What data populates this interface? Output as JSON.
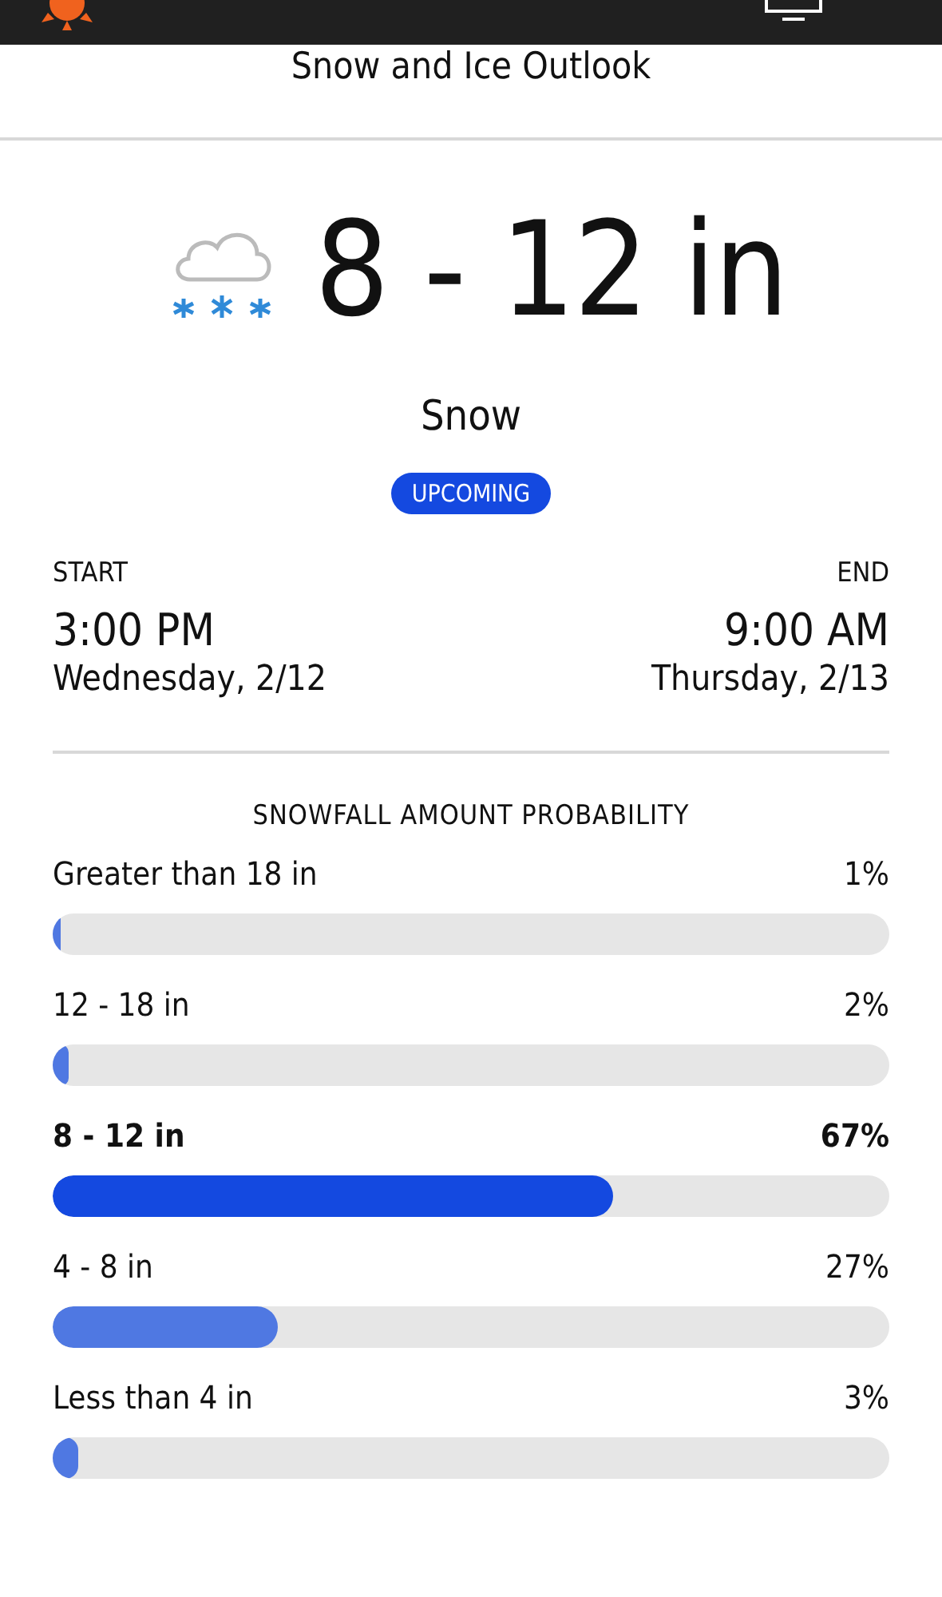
{
  "header": {
    "title": "Snow and Ice Outlook"
  },
  "forecast": {
    "amount": "8 - 12 in",
    "condition": "Snow",
    "badge": "UPCOMING"
  },
  "start": {
    "label": "START",
    "time": "3:00 PM",
    "date": "Wednesday, 2/12"
  },
  "end": {
    "label": "END",
    "time": "9:00 AM",
    "date": "Thursday, 2/13"
  },
  "probability": {
    "title": "SNOWFALL AMOUNT PROBABILITY",
    "rows": [
      {
        "label": "Greater than 18 in",
        "percent": "1%",
        "level": 0.01,
        "selected": false
      },
      {
        "label": "12 - 18 in",
        "percent": "2%",
        "level": 0.02,
        "selected": false
      },
      {
        "label": "8 - 12 in",
        "percent": "67%",
        "level": 0.67,
        "selected": true
      },
      {
        "label": "4 - 8 in",
        "percent": "27%",
        "level": 0.27,
        "selected": false
      },
      {
        "label": "Less than 4 in",
        "percent": "3%",
        "level": 0.03,
        "selected": false
      }
    ]
  }
}
